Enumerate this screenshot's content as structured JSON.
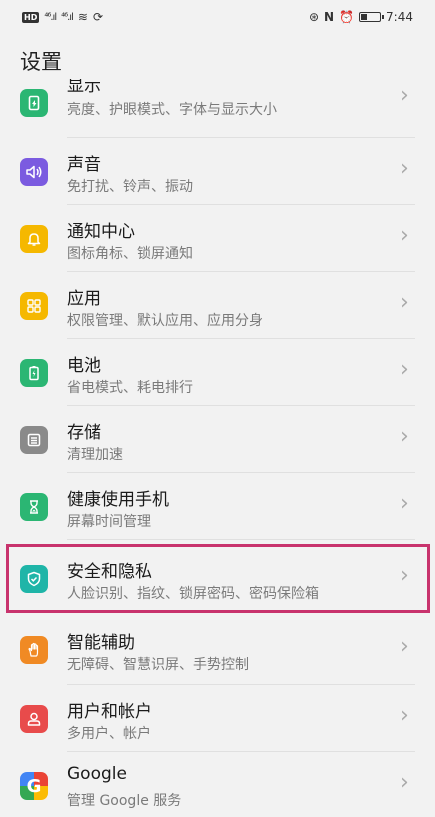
{
  "status_bar": {
    "hd": "HD",
    "signal1": "⁴⁶.ıl",
    "signal2": "⁴⁶.ıl",
    "wifi": "≋",
    "time": "7:44"
  },
  "page": {
    "title": "设置"
  },
  "items": [
    {
      "title": "显示",
      "subtitle": "亮度、护眼模式、字体与显示大小",
      "icon": "display-icon",
      "color": "#2bb673"
    },
    {
      "title": "声音",
      "subtitle": "免打扰、铃声、振动",
      "icon": "sound-icon",
      "color": "#7b5be0"
    },
    {
      "title": "通知中心",
      "subtitle": "图标角标、锁屏通知",
      "icon": "bell-icon",
      "color": "#f5b800"
    },
    {
      "title": "应用",
      "subtitle": "权限管理、默认应用、应用分身",
      "icon": "apps-icon",
      "color": "#f5b800"
    },
    {
      "title": "电池",
      "subtitle": "省电模式、耗电排行",
      "icon": "battery-icon",
      "color": "#2bb673"
    },
    {
      "title": "存储",
      "subtitle": "清理加速",
      "icon": "storage-icon",
      "color": "#8a8a8a"
    },
    {
      "title": "健康使用手机",
      "subtitle": "屏幕时间管理",
      "icon": "hourglass-icon",
      "color": "#2bb673"
    },
    {
      "title": "安全和隐私",
      "subtitle": "人脸识别、指纹、锁屏密码、密码保险箱",
      "icon": "shield-icon",
      "color": "#1fb5a8"
    },
    {
      "title": "智能辅助",
      "subtitle": "无障碍、智慧识屏、手势控制",
      "icon": "hand-icon",
      "color": "#f08a24"
    },
    {
      "title": "用户和帐户",
      "subtitle": "多用户、帐户",
      "icon": "user-icon",
      "color": "#e84b4b"
    },
    {
      "title": "Google",
      "subtitle": "管理 Google 服务",
      "icon": "google-icon",
      "color": "#ffffff"
    }
  ]
}
